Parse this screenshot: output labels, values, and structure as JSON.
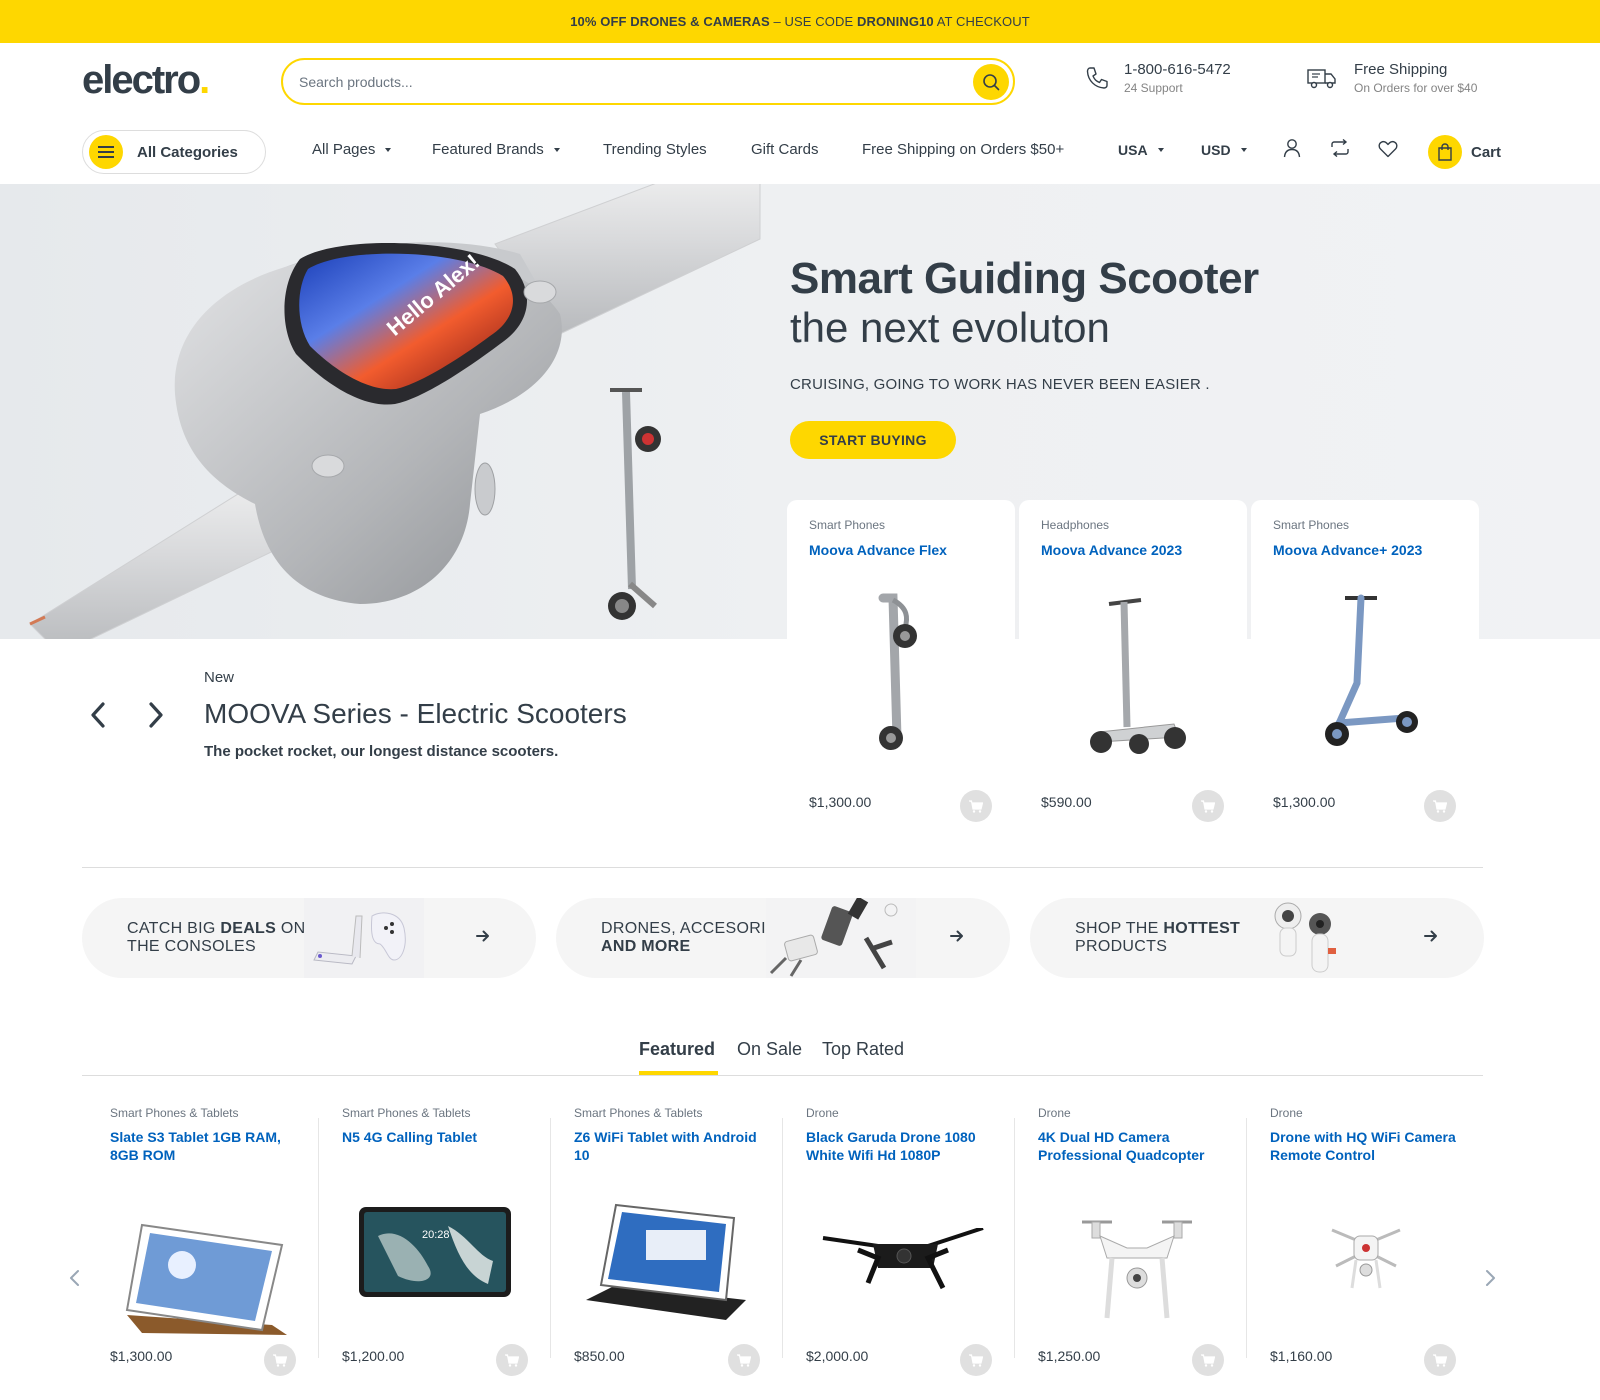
{
  "topbar": {
    "part1": "10% OFF DRONES & CAMERAS",
    "part2": " – USE CODE ",
    "code": "DRONING10",
    "part3": " AT CHECKOUT"
  },
  "header": {
    "logo_text": "electro",
    "logo_dot": ".",
    "search_placeholder": "Search products...",
    "phone": "1-800-616-5472",
    "phone_sub": "24 Support",
    "shipping": "Free Shipping",
    "shipping_sub": "On Orders for over $40"
  },
  "nav": {
    "all_categories": "All Categories",
    "items": [
      "All Pages",
      "Featured Brands",
      "Trending Styles",
      "Gift Cards",
      "Free Shipping on Orders $50+"
    ],
    "country": "USA",
    "currency": "USD",
    "cart": "Cart"
  },
  "hero": {
    "title": "Smart Guiding Scooter",
    "subtitle": "the next evoluton",
    "tagline": "CRUISING, GOING TO WORK HAS NEVER BEEN EASIER .",
    "button": "START BUYING",
    "screen_text": "Hello Alex!"
  },
  "hero_products": [
    {
      "category": "Smart Phones",
      "name": "Moova Advance Flex",
      "price": "$1,300.00"
    },
    {
      "category": "Headphones",
      "name": "Moova Advance 2023",
      "price": "$590.00"
    },
    {
      "category": "Smart Phones",
      "name": "Moova Advance+ 2023",
      "price": "$1,300.00"
    }
  ],
  "series": {
    "badge": "New",
    "title": "MOOVA Series - Electric Scooters",
    "description": "The pocket rocket, our longest distance scooters."
  },
  "promos": [
    {
      "pre": "CATCH BIG ",
      "bold": "DEALS",
      "post": " ON",
      "line2": "THE CONSOLES"
    },
    {
      "pre": "DRONES, ACCESORIES",
      "bold": "",
      "post": "",
      "line2": "AND MORE"
    },
    {
      "pre": "SHOP THE ",
      "bold": "HOTTEST",
      "post": "",
      "line2": "PRODUCTS"
    }
  ],
  "tabs": [
    "Featured",
    "On Sale",
    "Top Rated"
  ],
  "featured": [
    {
      "category": "Smart Phones & Tablets",
      "name": "Slate S3 Tablet 1GB RAM, 8GB ROM",
      "price": "$1,300.00"
    },
    {
      "category": "Smart Phones & Tablets",
      "name": "N5 4G Calling Tablet",
      "price": "$1,200.00"
    },
    {
      "category": "Smart Phones & Tablets",
      "name": "Z6 WiFi Tablet with Android 10",
      "price": "$850.00"
    },
    {
      "category": "Drone",
      "name": "Black Garuda Drone 1080 White Wifi Hd 1080P",
      "price": "$2,000.00"
    },
    {
      "category": "Drone",
      "name": "4K Dual HD Camera Professional Quadcopter",
      "price": "$1,250.00"
    },
    {
      "category": "Drone",
      "name": "Drone with HQ WiFi Camera Remote Control",
      "price": "$1,160.00"
    }
  ],
  "tablet_clock": "20:28",
  "colors": {
    "accent": "#fed700",
    "text": "#333e48",
    "link": "#0062bd"
  }
}
